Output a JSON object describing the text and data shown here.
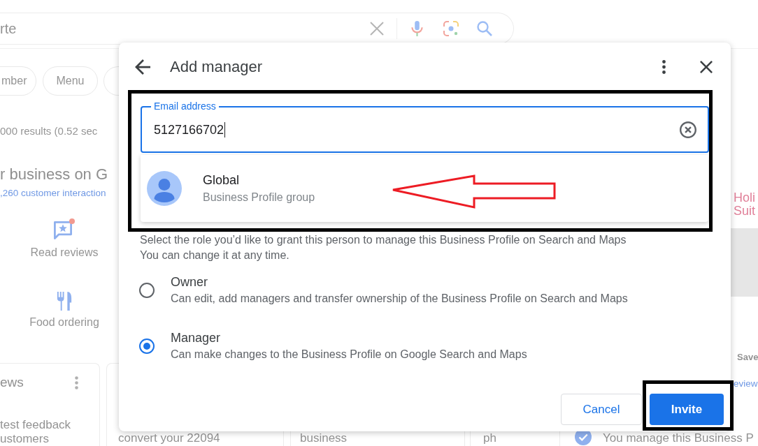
{
  "background_page": {
    "search_bar": {
      "query": "rte"
    },
    "chips": [
      {
        "label": "mber"
      },
      {
        "label": "Menu"
      }
    ],
    "results_count": "000 results (0.52 sec",
    "business": {
      "title": "r business on G",
      "interactions": ",260 customer interaction",
      "actions": [
        {
          "kind": "reviews",
          "label": "Read reviews",
          "notification": true
        },
        {
          "kind": "food",
          "label": "Food ordering",
          "notification": false
        }
      ]
    },
    "reviews_card": {
      "title": "ews",
      "lines": [
        "test feedback",
        "ustomers"
      ]
    },
    "cards": [
      "convert your 22094",
      "business",
      "ph"
    ],
    "side_panel": {
      "logo": [
        "Holi",
        "Suit"
      ],
      "save": "Save",
      "link": "eview",
      "managed_note": "You manage this Business P"
    }
  },
  "dialog": {
    "title": "Add manager",
    "email": {
      "label": "Email address",
      "value": "5127166702",
      "focused": true
    },
    "suggestions": [
      {
        "name": "Global",
        "subtitle": "Business Profile group"
      }
    ],
    "instructions": [
      "Select the role you’d like to grant this person to manage this Business Profile on Search and Maps",
      "You can change it at any time."
    ],
    "roles": [
      {
        "label": "Owner",
        "description": "Can edit, add managers and transfer ownership of the Business Profile on Search and Maps",
        "selected": false
      },
      {
        "label": "Manager",
        "description": "Can make changes to the Business Profile on Google Search and Maps",
        "selected": true
      }
    ],
    "buttons": [
      {
        "kind": "secondary",
        "label": "Cancel"
      },
      {
        "kind": "primary",
        "label": "Invite"
      }
    ]
  }
}
